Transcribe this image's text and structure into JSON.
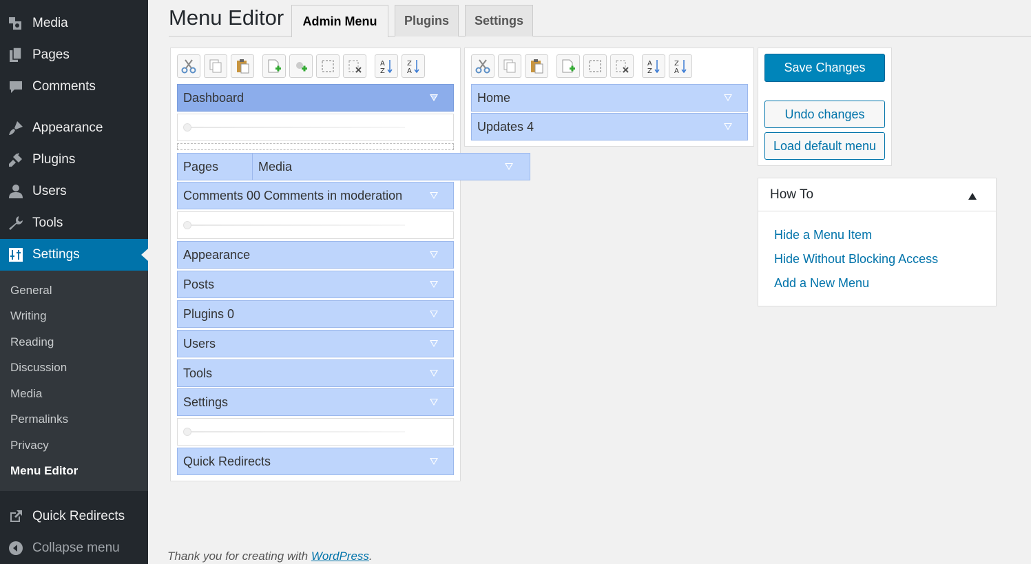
{
  "sidebar": {
    "items": [
      {
        "label": "Media",
        "icon": "media-icon"
      },
      {
        "label": "Pages",
        "icon": "pages-icon"
      },
      {
        "label": "Comments",
        "icon": "comments-icon"
      },
      {
        "label": "Appearance",
        "icon": "appearance-icon"
      },
      {
        "label": "Plugins",
        "icon": "plugins-icon"
      },
      {
        "label": "Users",
        "icon": "users-icon"
      },
      {
        "label": "Tools",
        "icon": "tools-icon"
      },
      {
        "label": "Settings",
        "icon": "settings-icon"
      }
    ],
    "submenu": [
      "General",
      "Writing",
      "Reading",
      "Discussion",
      "Media",
      "Permalinks",
      "Privacy",
      "Menu Editor"
    ],
    "quick_redirects": "Quick Redirects",
    "collapse": "Collapse menu"
  },
  "header": {
    "title": "Menu Editor",
    "tabs": [
      "Admin Menu",
      "Plugins",
      "Settings"
    ]
  },
  "left_panel": {
    "items": {
      "dashboard": "Dashboard",
      "pages": "Pages",
      "comments": "Comments 00 Comments in moderation",
      "appearance": "Appearance",
      "posts": "Posts",
      "plugins": "Plugins 0",
      "users": "Users",
      "tools": "Tools",
      "settings": "Settings",
      "quick_redirects": "Quick Redirects"
    },
    "dragging": "Media"
  },
  "right_panel": {
    "items": [
      "Home",
      "Updates 4"
    ]
  },
  "actions": {
    "save": "Save Changes",
    "undo": "Undo changes",
    "load_default": "Load default menu"
  },
  "howto": {
    "title": "How To",
    "links": [
      "Hide a Menu Item",
      "Hide Without Blocking Access",
      "Add a New Menu"
    ]
  },
  "footer": {
    "text": "Thank you for creating with ",
    "link": "WordPress",
    "end": "."
  },
  "colors": {
    "sidebar_bg": "#23282d",
    "active_blue": "#0073aa",
    "menu_item_bg": "#bed5fc",
    "selected_item_bg": "#8cadeb"
  }
}
